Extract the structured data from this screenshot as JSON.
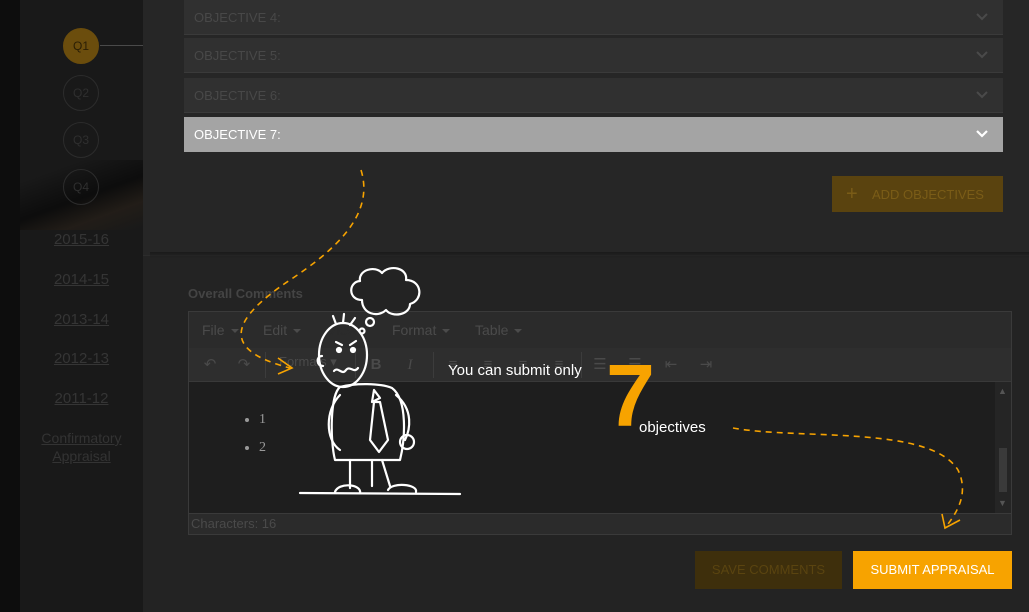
{
  "sidebar": {
    "quarters": [
      "Q1",
      "Q2",
      "Q3",
      "Q4"
    ],
    "active_quarter": "Q1",
    "years": [
      "2015-16",
      "2014-15",
      "2013-14",
      "2012-13",
      "2011-12"
    ],
    "confirmatory": [
      "Confirmatory",
      "Appraisal"
    ]
  },
  "objectives": [
    {
      "label": "OBJECTIVE 4:"
    },
    {
      "label": "OBJECTIVE 5:"
    },
    {
      "label": "OBJECTIVE 6:"
    },
    {
      "label": "OBJECTIVE 7:"
    }
  ],
  "add_objectives_label": "ADD OBJECTIVES",
  "overall_comments": {
    "label": "Overall Comments",
    "menu": [
      "File",
      "Edit",
      "View",
      "Format",
      "Table"
    ],
    "formats_label": "Formats",
    "list_items": [
      "1",
      "2"
    ],
    "characters": "Characters: 16"
  },
  "buttons": {
    "save_comments": "SAVE COMMENTS",
    "submit_appraisal": "SUBMIT APPRAISAL"
  },
  "tooltip": {
    "line1": "You can submit only",
    "number": "7",
    "line2": "objectives"
  },
  "colors": {
    "accent": "#f7a300",
    "background": "#1f1f1f"
  }
}
